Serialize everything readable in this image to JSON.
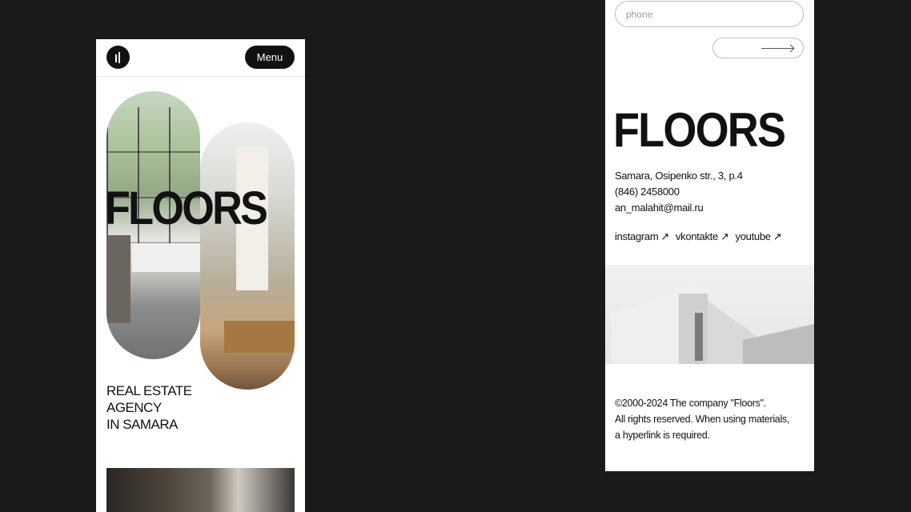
{
  "left_screen": {
    "menu_label": "Menu",
    "hero_title": "FLOORS",
    "tagline": [
      "REAL ESTATE",
      "AGENCY",
      "IN SAMARA"
    ]
  },
  "right_screen": {
    "phone_placeholder": "phone",
    "brand_title": "FLOORS",
    "address": "Samara, Osipenko str., 3, p.4",
    "phone": "(846) 2458000",
    "email": "an_malahit@mail.ru",
    "socials": [
      {
        "label": "instagram",
        "arrow": "↗"
      },
      {
        "label": "vkontakte",
        "arrow": "↗"
      },
      {
        "label": "youtube",
        "arrow": "↗"
      }
    ],
    "copyright": [
      "©2000-2024 The company \"Floors\".",
      "All rights reserved. When using materials,",
      "a hyperlink is required."
    ]
  },
  "colors": {
    "background": "#1a1a1a",
    "surface": "#ffffff",
    "ink": "#111111"
  }
}
